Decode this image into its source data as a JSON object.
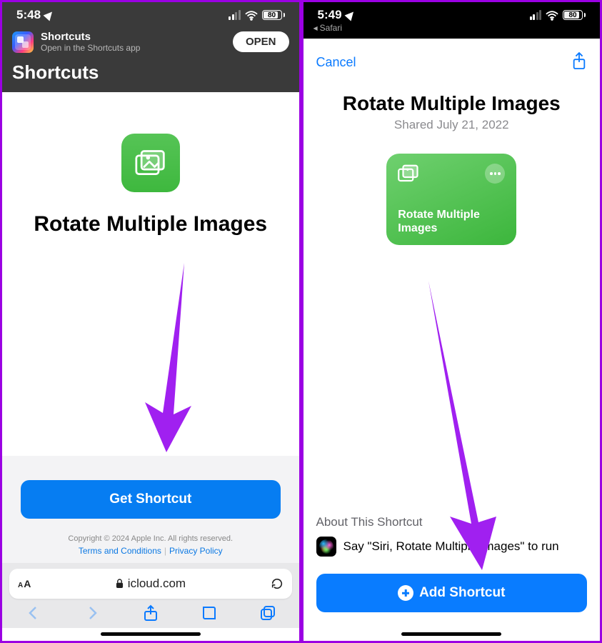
{
  "left": {
    "status": {
      "time": "5:48",
      "battery": "80"
    },
    "banner": {
      "name": "Shortcuts",
      "sub": "Open in the Shortcuts app",
      "open": "OPEN"
    },
    "header": "Shortcuts",
    "title": "Rotate Multiple Images",
    "get_btn": "Get Shortcut",
    "copyright": "Copyright © 2024 Apple Inc. All rights reserved.",
    "terms": "Terms and Conditions",
    "privacy": "Privacy Policy",
    "url": "icloud.com"
  },
  "right": {
    "status": {
      "time": "5:49",
      "battery": "80"
    },
    "back": "Safari",
    "cancel": "Cancel",
    "title": "Rotate Multiple Images",
    "shared": "Shared July 21, 2022",
    "card_title": "Rotate Multiple Images",
    "about": "About This Shortcut",
    "siri_text": "Say \"Siri, Rotate Multiple Images\" to run",
    "add_btn": "Add Shortcut"
  }
}
